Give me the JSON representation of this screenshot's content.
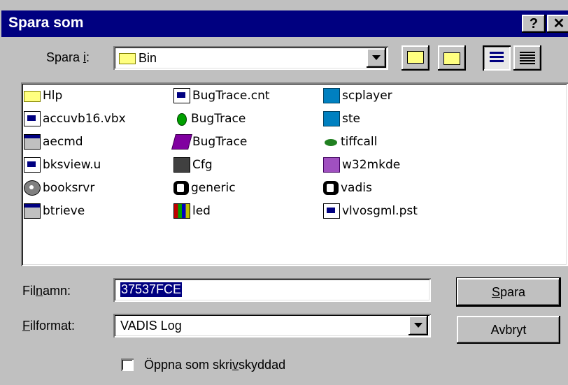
{
  "window": {
    "title": "Spara som",
    "help_label": "?",
    "close_label": "✕"
  },
  "savein": {
    "label": "Spara i:",
    "label_parts": [
      "Spara ",
      "i",
      ":"
    ],
    "value": "Bin"
  },
  "toolbar": {
    "up_icon": "folder-up-icon",
    "new_folder_icon": "new-folder-icon",
    "list_view_icon": "list-view-icon",
    "details_view_icon": "details-view-icon"
  },
  "files": {
    "col1": [
      {
        "name": "Hlp",
        "icon": "folder"
      },
      {
        "name": "accuvb16.vbx",
        "icon": "doc"
      },
      {
        "name": "aecmd",
        "icon": "app"
      },
      {
        "name": "bksview.u",
        "icon": "doc"
      },
      {
        "name": "booksrvr",
        "icon": "disc"
      },
      {
        "name": "btrieve",
        "icon": "app"
      }
    ],
    "col2": [
      {
        "name": "BugTrace.cnt",
        "icon": "doc"
      },
      {
        "name": "BugTrace",
        "icon": "bug"
      },
      {
        "name": "BugTrace",
        "icon": "book"
      },
      {
        "name": "Cfg",
        "icon": "tool2"
      },
      {
        "name": "generic",
        "icon": "vad"
      },
      {
        "name": "led",
        "icon": "grid"
      }
    ],
    "col3": [
      {
        "name": "scplayer",
        "icon": "blue"
      },
      {
        "name": "ste",
        "icon": "blue"
      },
      {
        "name": "tiffcall",
        "icon": "frog"
      },
      {
        "name": "w32mkde",
        "icon": "purple"
      },
      {
        "name": "vadis",
        "icon": "vad"
      },
      {
        "name": "vlvosgml.pst",
        "icon": "doc"
      }
    ]
  },
  "filename": {
    "label_parts": [
      "Fil",
      "n",
      "amn:"
    ],
    "value": "37537FCE"
  },
  "fileformat": {
    "label_parts": [
      "",
      "F",
      "ilformat:"
    ],
    "value": "VADIS Log"
  },
  "buttons": {
    "save_parts": [
      "",
      "S",
      "para"
    ],
    "cancel": "Avbryt"
  },
  "readonly": {
    "label_parts": [
      "Öppna som skri",
      "v",
      "skyddad"
    ],
    "checked": false
  },
  "colors": {
    "titlebar": "#000080",
    "face": "#c0c0c0",
    "selection": "#000080"
  }
}
